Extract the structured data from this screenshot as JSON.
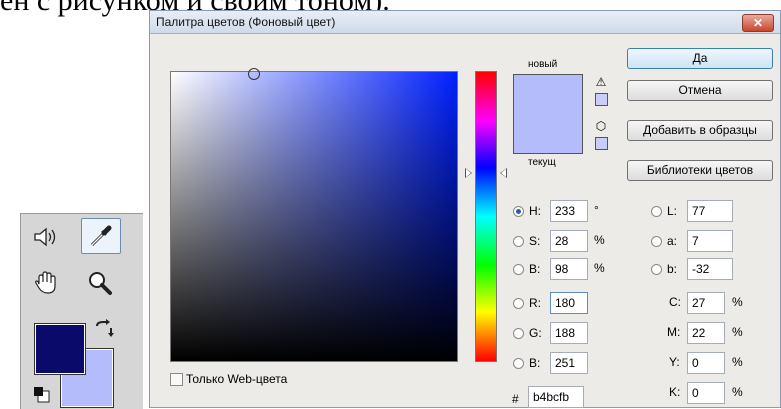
{
  "background_text": "ен с рисунком и своим тоном).",
  "dialog": {
    "title": "Палитра цветов (Фоновый цвет)",
    "close_label": "✕",
    "label_new": "новый",
    "label_current": "текущ",
    "new_color": "#b4bcfb",
    "current_color": "#b4bcfb",
    "buttons": {
      "ok": "Да",
      "cancel": "Отмена",
      "add_to_swatches": "Добавить в образцы",
      "color_libraries": "Библиотеки цветов"
    },
    "web_only_label": "Только Web-цвета",
    "hsb": [
      {
        "label": "H:",
        "value": "233",
        "unit": "°",
        "selected": true
      },
      {
        "label": "S:",
        "value": "28",
        "unit": "%",
        "selected": false
      },
      {
        "label": "B:",
        "value": "98",
        "unit": "%",
        "selected": false
      }
    ],
    "rgb": [
      {
        "label": "R:",
        "value": "180"
      },
      {
        "label": "G:",
        "value": "188"
      },
      {
        "label": "B:",
        "value": "251"
      }
    ],
    "lab": [
      {
        "label": "L:",
        "value": "77"
      },
      {
        "label": "a:",
        "value": "7"
      },
      {
        "label": "b:",
        "value": "-32"
      }
    ],
    "cmyk": [
      {
        "label": "C:",
        "value": "27",
        "unit": "%"
      },
      {
        "label": "M:",
        "value": "22",
        "unit": "%"
      },
      {
        "label": "Y:",
        "value": "0",
        "unit": "%"
      },
      {
        "label": "K:",
        "value": "0",
        "unit": "%"
      }
    ],
    "hex_label": "#",
    "hex_value": "b4bcfb"
  },
  "toolbox": {
    "foreground_color": "#0a0a6a",
    "background_color": "#b4bcfb",
    "tools": [
      "speaker-icon",
      "eyedropper-icon",
      "hand-icon",
      "zoom-icon"
    ]
  }
}
